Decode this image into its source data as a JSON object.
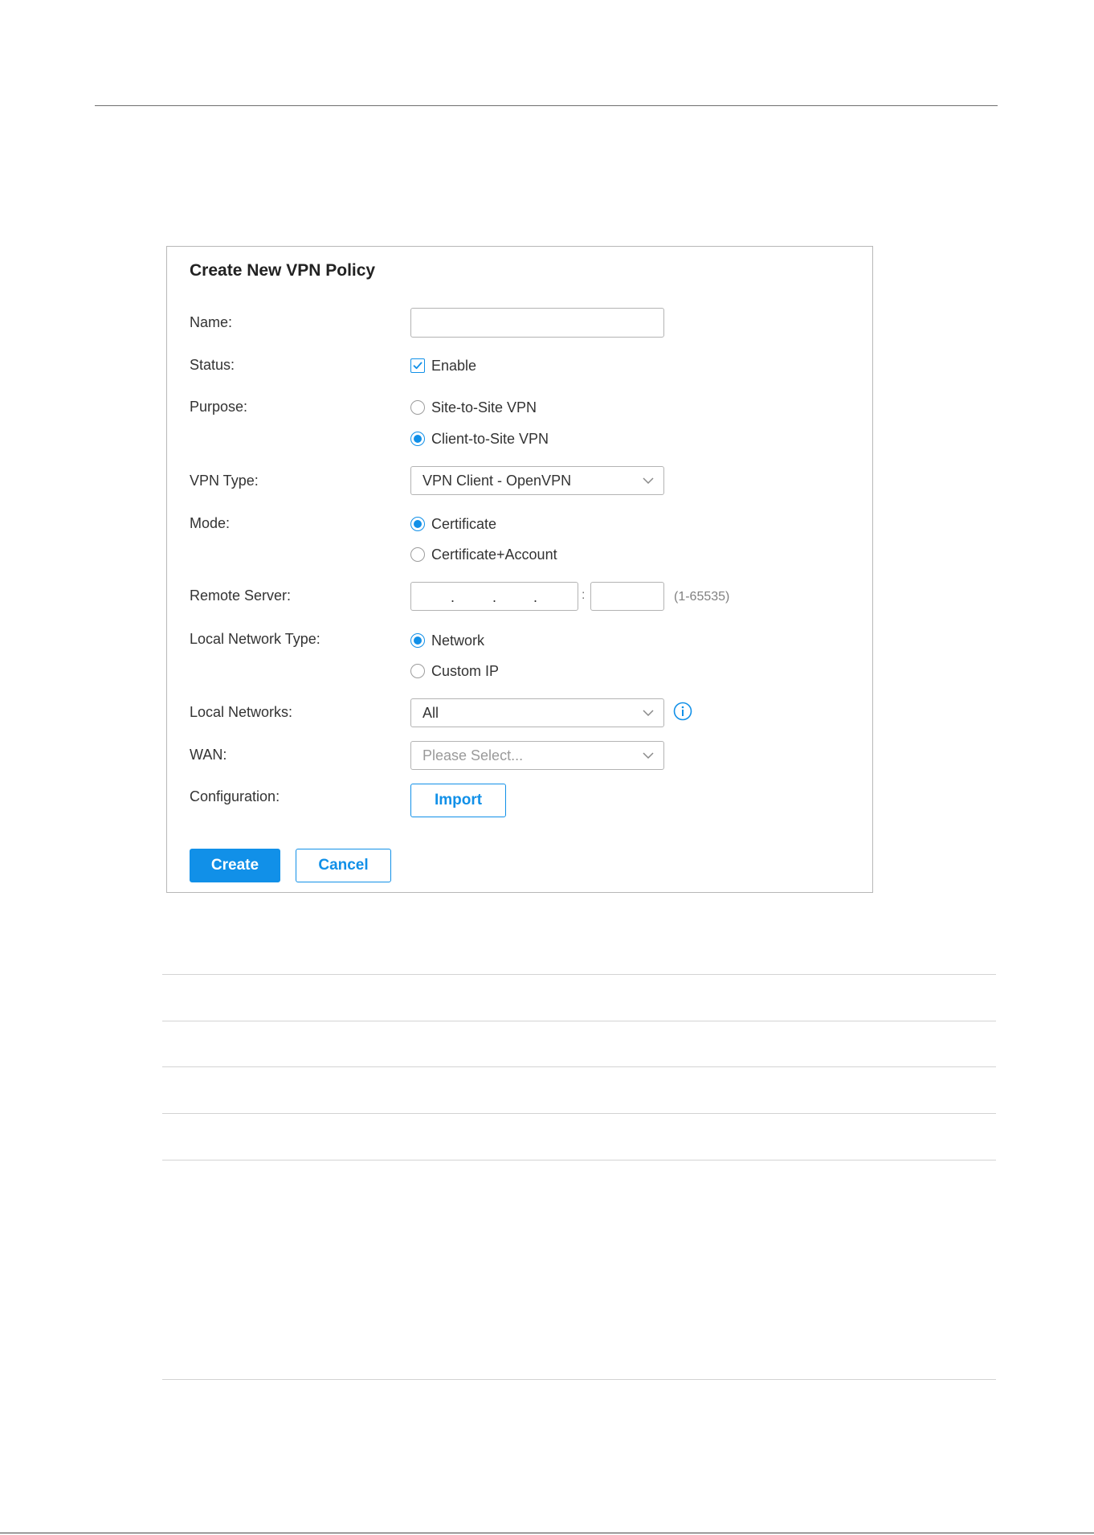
{
  "dialog": {
    "title": "Create New VPN Policy",
    "name": {
      "label": "Name:",
      "value": ""
    },
    "status": {
      "label": "Status:",
      "checkbox_label": "Enable",
      "checked": true
    },
    "purpose": {
      "label": "Purpose:",
      "options": [
        "Site-to-Site VPN",
        "Client-to-Site VPN"
      ],
      "selected": "Client-to-Site VPN"
    },
    "vpn_type": {
      "label": "VPN Type:",
      "value": "VPN Client - OpenVPN"
    },
    "mode": {
      "label": "Mode:",
      "options": [
        "Certificate",
        "Certificate+Account"
      ],
      "selected": "Certificate"
    },
    "remote_server": {
      "label": "Remote Server:",
      "ip_separators": [
        ".",
        ".",
        "."
      ],
      "port_separator": ":",
      "port_hint": "(1-65535)"
    },
    "local_network_type": {
      "label": "Local Network Type:",
      "options": [
        "Network",
        "Custom IP"
      ],
      "selected": "Network"
    },
    "local_networks": {
      "label": "Local Networks:",
      "value": "All"
    },
    "wan": {
      "label": "WAN:",
      "placeholder": "Please Select..."
    },
    "configuration": {
      "label": "Configuration:",
      "button": "Import"
    },
    "create_button": "Create",
    "cancel_button": "Cancel"
  },
  "colors": {
    "accent": "#1190e8",
    "border": "#b3b3b3",
    "text": "#333333"
  },
  "icons": {
    "select_arrow": "chevron-down-icon",
    "info": "info-icon",
    "checkmark": "check-icon"
  }
}
